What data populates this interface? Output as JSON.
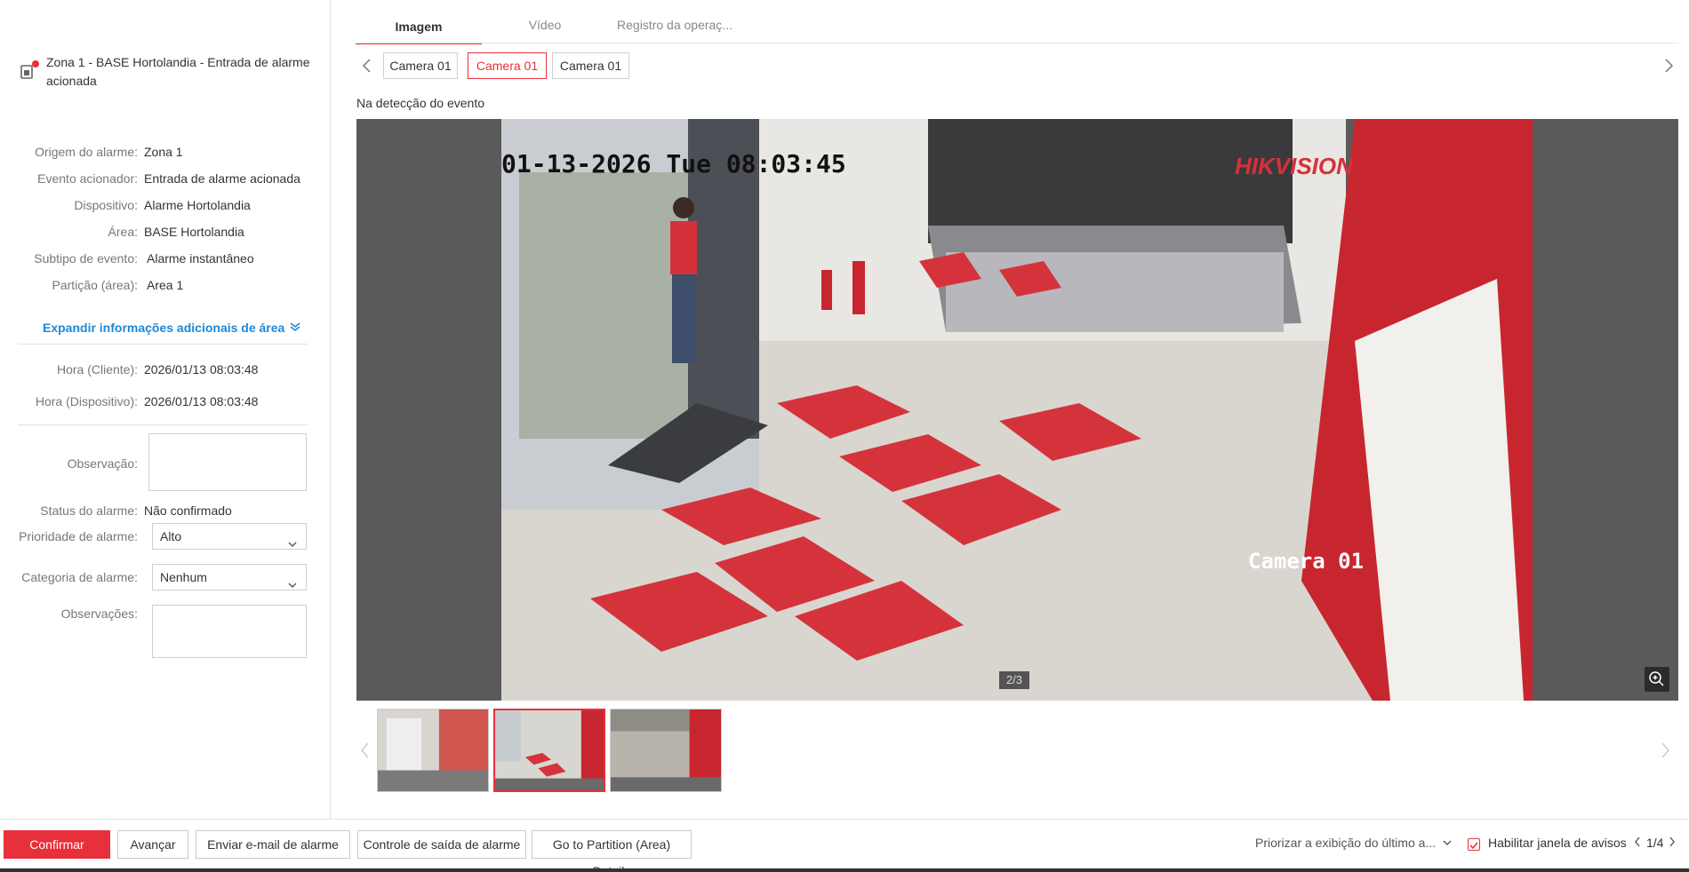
{
  "alarm": {
    "title": "Zona 1 - BASE Hortolandia - Entrada de alarme acionada"
  },
  "details": [
    {
      "label": "Origem do alarme:",
      "value": "Zona 1"
    },
    {
      "label": "Evento acionador:",
      "value": "Entrada de alarme acionada"
    },
    {
      "label": "Dispositivo:",
      "value": "Alarme Hortolandia"
    },
    {
      "label": "Área:",
      "value": "BASE Hortolandia"
    },
    {
      "label": "Subtipo de evento:",
      "value": "Alarme instantâneo"
    },
    {
      "label": "Partição (área):",
      "value": "Area 1"
    }
  ],
  "expand_link": "Expandir informações adicionais de área",
  "times": [
    {
      "label": "Hora (Cliente):",
      "value": "2026/01/13 08:03:48"
    },
    {
      "label": "Hora (Dispositivo):",
      "value": "2026/01/13 08:03:48"
    }
  ],
  "form": {
    "observacao_label": "Observação:",
    "status_label": "Status do alarme:",
    "status_value": "Não confirmado",
    "prioridade_label": "Prioridade de alarme:",
    "prioridade_value": "Alto",
    "categoria_label": "Categoria de alarme:",
    "categoria_value": "Nenhum",
    "observacoes_label": "Observações:"
  },
  "tabs": [
    "Imagem",
    "Vídeo",
    "Registro da operaç..."
  ],
  "cameras": [
    "Camera 01",
    "Camera 01",
    "Camera 01"
  ],
  "event_caption": "Na detecção do evento",
  "image": {
    "timestamp_osd": "01-13-2026 Tue 08:03:45",
    "camera_osd": "Camera 01",
    "brand_osd": "HIKVISION",
    "page_indicator": "2/3"
  },
  "bottom": {
    "confirm": "Confirmar",
    "advance": "Avançar",
    "email": "Enviar e-mail de alarme",
    "output": "Controle de saída de alarme",
    "partition": "Go to Partition (Area) Details",
    "priority_display": "Priorizar a exibição do último a...",
    "enable_window": "Habilitar janela de avisos",
    "pager": "1/4"
  },
  "colors": {
    "accent": "#e8303a",
    "link": "#1e88d6"
  }
}
